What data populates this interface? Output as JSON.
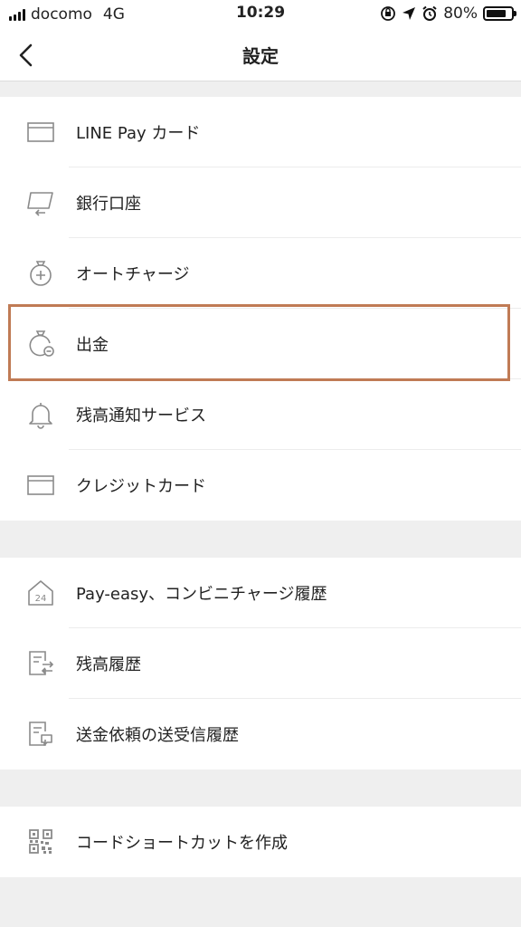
{
  "status_bar": {
    "carrier": "docomo",
    "network": "4G",
    "time": "10:29",
    "battery": "80%",
    "battery_level": 0.8
  },
  "nav": {
    "title": "設定",
    "back_icon": "chevron-left-icon"
  },
  "section1": [
    {
      "label": "LINE Pay カード",
      "icon": "card-icon"
    },
    {
      "label": "銀行口座",
      "icon": "bank-transfer-icon"
    },
    {
      "label": "オートチャージ",
      "icon": "auto-charge-icon"
    },
    {
      "label": "出金",
      "icon": "withdraw-icon"
    },
    {
      "label": "残高通知サービス",
      "icon": "bell-icon"
    },
    {
      "label": "クレジットカード",
      "icon": "credit-card-icon"
    }
  ],
  "section2": [
    {
      "label": "Pay-easy、コンビニチャージ履歴",
      "icon": "store-24-icon"
    },
    {
      "label": "残高履歴",
      "icon": "balance-history-icon"
    },
    {
      "label": "送金依頼の送受信履歴",
      "icon": "request-history-icon"
    }
  ],
  "section3": [
    {
      "label": "コードショートカットを作成",
      "icon": "qr-code-icon"
    }
  ],
  "colors": {
    "highlight_border": "#c07b55",
    "background": "#efefef",
    "icon_stroke": "#8a8a8a"
  }
}
